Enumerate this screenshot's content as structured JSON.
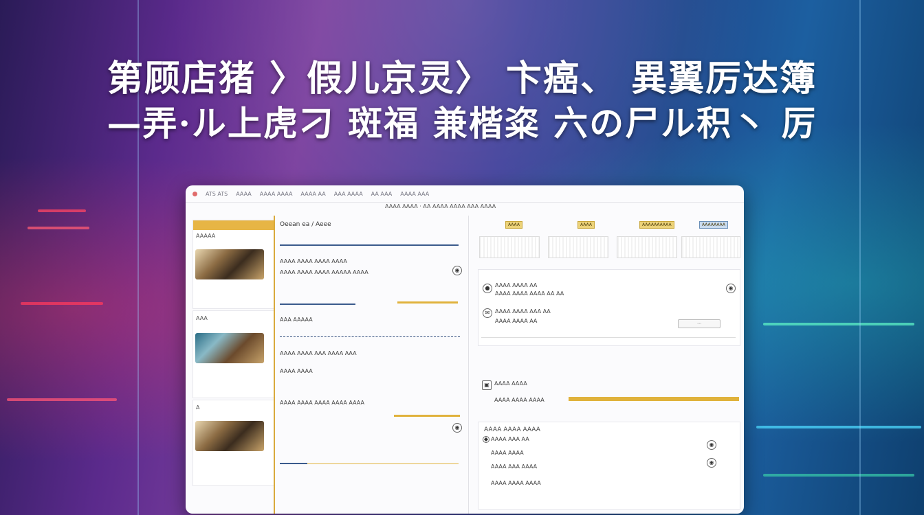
{
  "headline": {
    "line1": "第顾店猪 〉假儿京灵〉 卞癌、 異翼厉达簿",
    "line2": "—弄·ル上虎刁 斑福 兼楷粢 六の尸ル积丶 厉"
  },
  "app": {
    "title_items": [
      "ATS ATS",
      "AAAA",
      "AAAA AAAA",
      "AAAA AA",
      "AAA AAAA",
      "AA AAA",
      "AAAA AAA"
    ],
    "address": "AAAA AAAA · AA AAAA AAAA AAA AAAA"
  },
  "left": {
    "cards": [
      {
        "header": "AAAAA",
        "thumb": "thumbnail-1"
      },
      {
        "header": "AAA",
        "thumb": "thumbnail-2"
      },
      {
        "header": "A",
        "thumb": "thumbnail-3"
      }
    ]
  },
  "middle": {
    "top_title": "Oeean ea / Aeee",
    "rows": [
      "AAAA AAAA AAAA AAAA",
      "AAAA AAAA AAAA AAAAA AAAA",
      "AAA AAAAA",
      "AAAA AAAA AAA AAAA AAA",
      "AAAA AAAA",
      "AAAA AAAA AAAA AAAA AAAA"
    ]
  },
  "right": {
    "top_pills": [
      "AAAA",
      "AAAA",
      "AAAAAAAAAA",
      "AAAAAAAA"
    ],
    "panel_rows": [
      "AAAA AAAA AA",
      "AAAA AAAA AAAA AA AA",
      "AAAA AAAA AAA AA",
      "AAAA AAAA AA",
      "AAAA AAAA",
      "AAAA AAAA AAAA",
      "AAAA AAA AA",
      "AAAA AAAA",
      "AAAA AAA AAAA",
      "AAAA AAAA AAAA"
    ],
    "footer_title": "AAAA AAAA AAAA"
  }
}
